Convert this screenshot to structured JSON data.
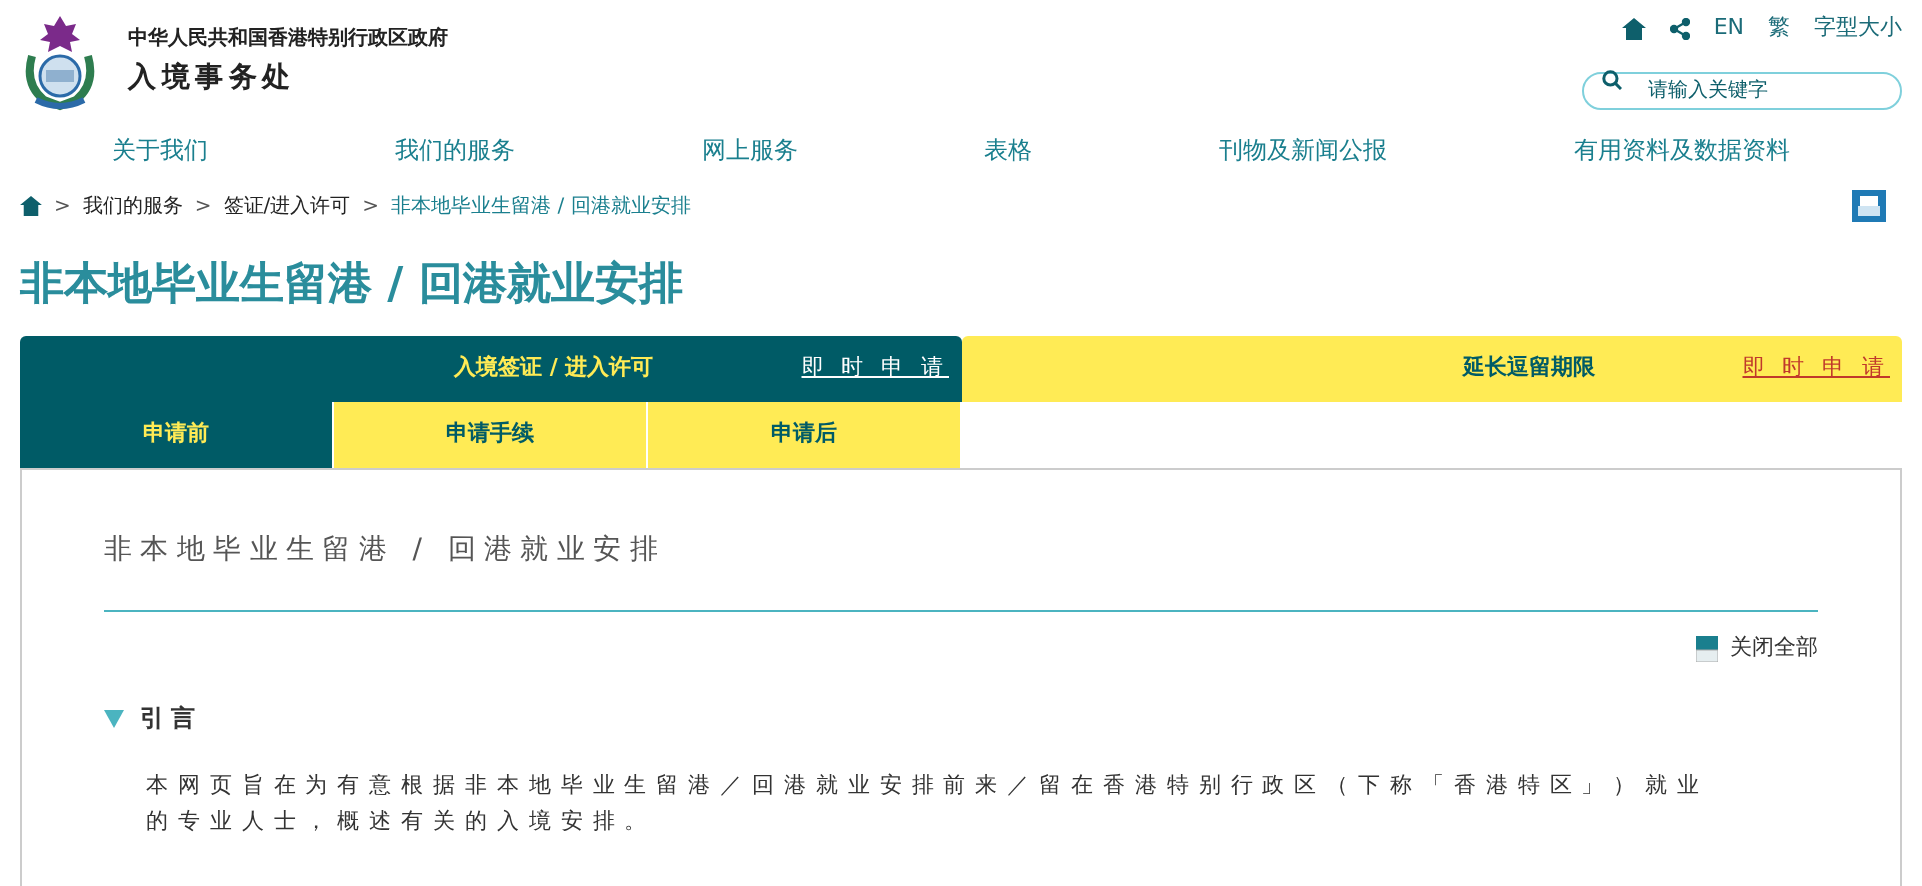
{
  "header": {
    "government": "中华人民共和国香港特别行政区政府",
    "department": "入境事务处",
    "utility_links": [
      "EN",
      "繁",
      "字型大小"
    ],
    "search": {
      "placeholder": "请输入关键字"
    }
  },
  "nav": [
    "关于我们",
    "我们的服务",
    "网上服务",
    "表格",
    "刊物及新闻公报",
    "有用资料及数据资料"
  ],
  "breadcrumb": [
    {
      "separator": ">",
      "label": "我们的服务",
      "current": false
    },
    {
      "separator": ">",
      "label": "签证/进入许可",
      "current": false
    },
    {
      "separator": ">",
      "label": "非本地毕业生留港 / 回港就业安排",
      "current": true
    }
  ],
  "page_title": "非本地毕业生留港 / 回港就业安排",
  "top_tabs": [
    {
      "label": "入境签证 / 进入许可",
      "link": "即 时 申 请",
      "selected": true
    },
    {
      "label": "延长逗留期限",
      "link": "即 时 申 请",
      "selected": false
    }
  ],
  "sub_tabs": [
    {
      "label": "申请前",
      "selected": true
    },
    {
      "label": "申请手续",
      "selected": false
    },
    {
      "label": "申请后",
      "selected": false
    }
  ],
  "content": {
    "heading": "非本地毕业生留港 / 回港就业安排",
    "collapse_all": "关闭全部",
    "sections": [
      {
        "title": "引言",
        "expanded": true,
        "text": "本网页旨在为有意根据非本地毕业生留港／回港就业安排前来／留在香港特别行政区（下称「香港特区」）就业的专业人士，概述有关的入境安排。"
      }
    ]
  }
}
